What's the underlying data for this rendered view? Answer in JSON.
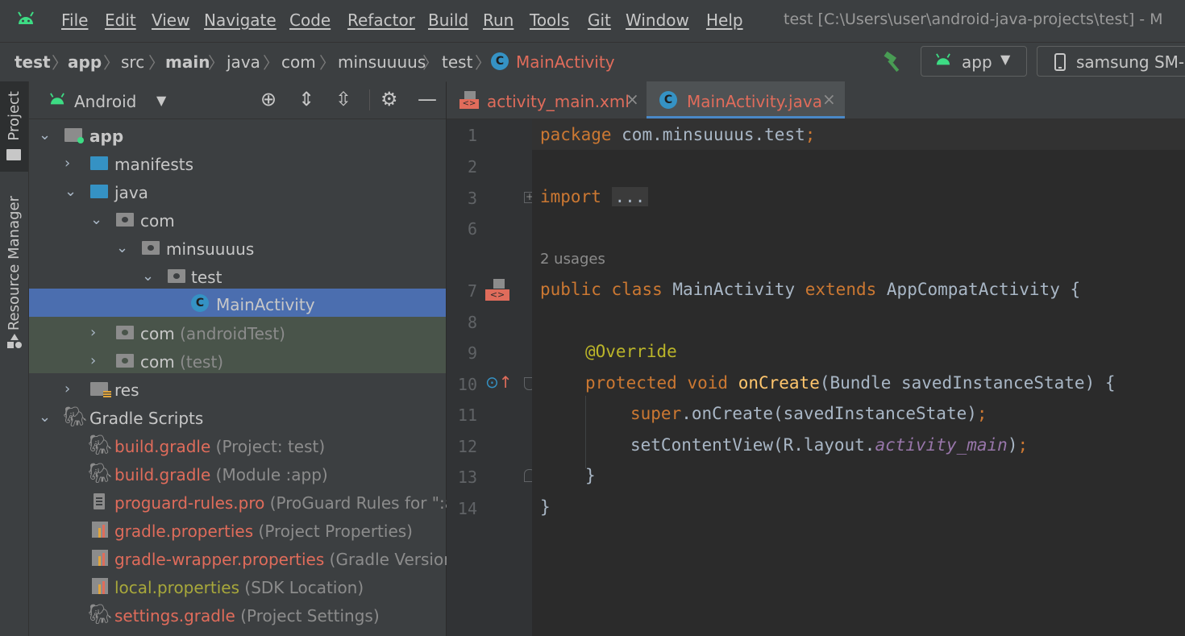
{
  "menubar": {
    "items": [
      "File",
      "Edit",
      "View",
      "Navigate",
      "Code",
      "Refactor",
      "Build",
      "Run",
      "Tools",
      "Git",
      "Window",
      "Help"
    ],
    "window_title": "test [C:\\Users\\user\\android-java-projects\\test] - M"
  },
  "navbar": {
    "breadcrumbs": [
      "test",
      "app",
      "src",
      "main",
      "java",
      "com",
      "minsuuuus",
      "test",
      "MainActivity"
    ],
    "run_config": "app",
    "device": "samsung SM-G"
  },
  "left_strip": {
    "tabs": [
      "Project",
      "Resource Manager"
    ]
  },
  "project": {
    "view_mode": "Android",
    "tree": [
      {
        "label": "app",
        "hint": ""
      },
      {
        "label": "manifests",
        "hint": ""
      },
      {
        "label": "java",
        "hint": ""
      },
      {
        "label": "com",
        "hint": ""
      },
      {
        "label": "minsuuuus",
        "hint": ""
      },
      {
        "label": "test",
        "hint": ""
      },
      {
        "label": "MainActivity",
        "hint": ""
      },
      {
        "label": "com",
        "hint": " (androidTest)"
      },
      {
        "label": "com",
        "hint": " (test)"
      },
      {
        "label": "res",
        "hint": ""
      },
      {
        "label": "Gradle Scripts",
        "hint": ""
      },
      {
        "label": "build.gradle",
        "hint": " (Project: test)"
      },
      {
        "label": "build.gradle",
        "hint": " (Module :app)"
      },
      {
        "label": "proguard-rules.pro",
        "hint": " (ProGuard Rules for \":ap"
      },
      {
        "label": "gradle.properties",
        "hint": " (Project Properties)"
      },
      {
        "label": "gradle-wrapper.properties",
        "hint": " (Gradle Version)"
      },
      {
        "label": "local.properties",
        "hint": " (SDK Location)"
      },
      {
        "label": "settings.gradle",
        "hint": " (Project Settings)"
      }
    ]
  },
  "editor": {
    "tabs": [
      {
        "label": "activity_main.xml"
      },
      {
        "label": "MainActivity.java"
      }
    ],
    "line_numbers": [
      "1",
      "2",
      "3",
      "6",
      "7",
      "8",
      "9",
      "10",
      "11",
      "12",
      "13",
      "14"
    ],
    "usages_hint": "2 usages",
    "code": {
      "l1_kw": "package",
      "l1_rest": " com.minsuuuus.test",
      "l1_semi": ";",
      "l3_kw": "import",
      "l3_fold": "...",
      "l7_kw1": "public",
      "l7_kw2": "class",
      "l7_name": " MainActivity ",
      "l7_kw3": "extends",
      "l7_rest": " AppCompatActivity {",
      "l9_ann": "@Override",
      "l10_kw1": "protected",
      "l10_kw2": "void",
      "l10_fn": "onCreate",
      "l10_rest": "(Bundle savedInstanceState) {",
      "l11_kw": "super",
      "l11_rest": ".onCreate(savedInstanceState)",
      "l11_semi": ";",
      "l12_a": "setContentView(R.layout.",
      "l12_field": "activity_main",
      "l12_b": ")",
      "l12_semi": ";",
      "l13": "}",
      "l14": "}"
    }
  },
  "colors": {
    "accent_selection": "#4b6eaf",
    "test_bg": "#49544a",
    "keyword": "#cc7832",
    "function": "#ffc66d",
    "annotation": "#bbb529",
    "field": "#9876aa",
    "modified_file": "#e06c5b"
  }
}
